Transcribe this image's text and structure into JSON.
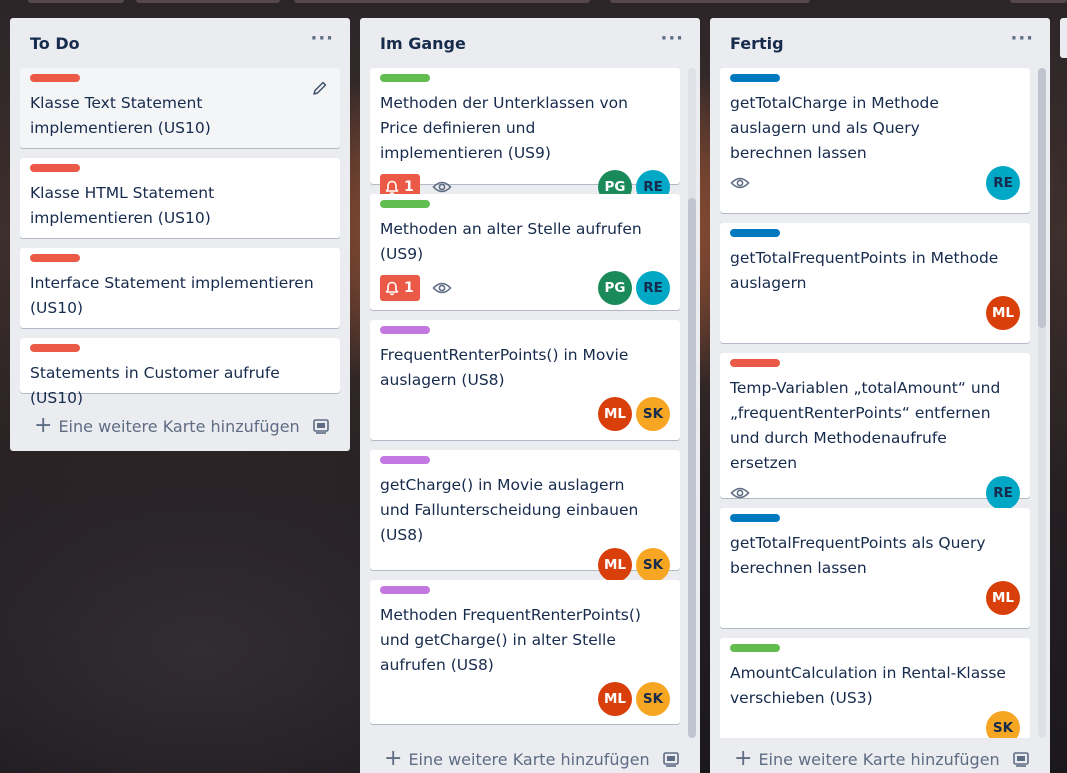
{
  "colors": {
    "label_red": "#eb5a46",
    "label_green": "#61bd4f",
    "label_purple": "#c377e0",
    "label_blue": "#0079bf",
    "due_badge": "#eb5a46",
    "avatar_PG": "#1b8a5a",
    "avatar_RE": "#00a8c6",
    "avatar_ML": "#d93f0b",
    "avatar_SK": "#f6a623"
  },
  "icons": {
    "list_menu": "ellipsis-icon",
    "edit": "pencil-icon",
    "due": "bell-icon",
    "watch": "eye-icon",
    "add": "plus-icon",
    "template": "card-template-icon"
  },
  "lists": [
    {
      "title": "To Do",
      "menu": "···",
      "add_label": "Eine weitere Karte hinzufügen",
      "cards": [
        {
          "label": "label_red",
          "text": "Klasse Text Statement implementieren (US10)"
        },
        {
          "label": "label_red",
          "text": "Klasse HTML Statement implementieren (US10)"
        },
        {
          "label": "label_red",
          "text": "Interface Statement implementieren (US10)"
        },
        {
          "label": "label_red",
          "text": "Statements in Customer aufrufe (US10)"
        }
      ]
    },
    {
      "title": "Im Gange",
      "menu": "···",
      "add_label": "Eine weitere Karte hinzufügen",
      "cards": [
        {
          "label": "label_green",
          "text": "Methoden der Unterklassen von Price definieren und implementieren (US9)",
          "due": "1",
          "members": [
            "PG",
            "RE"
          ]
        },
        {
          "label": "label_green",
          "text": "Methoden an alter Stelle aufrufen (US9)",
          "due": "1",
          "members": [
            "PG",
            "RE"
          ]
        },
        {
          "label": "label_purple",
          "text": "FrequentRenterPoints() in Movie auslagern (US8)",
          "members": [
            "ML",
            "SK"
          ]
        },
        {
          "label": "label_purple",
          "text": "getCharge() in Movie auslagern und Fallunterscheidung einbauen (US8)",
          "members": [
            "ML",
            "SK"
          ]
        },
        {
          "label": "label_purple",
          "text": "Methoden FrequentRenterPoints() und getCharge() in alter Stelle aufrufen (US8)",
          "members": [
            "ML",
            "SK"
          ]
        }
      ]
    },
    {
      "title": "Fertig",
      "menu": "···",
      "add_label": "Eine weitere Karte hinzufügen",
      "cards": [
        {
          "label": "label_blue",
          "text": "getTotalCharge in Methode auslagern und als Query berechnen lassen",
          "members": [
            "RE"
          ]
        },
        {
          "label": "label_blue",
          "text": "getTotalFrequentPoints in Methode auslagern",
          "members": [
            "ML"
          ]
        },
        {
          "label": "label_red",
          "text": "Temp-Variablen „totalAmount“ und „frequentRenterPoints“ entfernen und durch Methodenaufrufe ersetzen",
          "members": [
            "RE"
          ]
        },
        {
          "label": "label_blue",
          "text": "getTotalFrequentPoints als Query berechnen lassen",
          "members": [
            "ML"
          ]
        },
        {
          "label": "label_green",
          "text": "AmountCalculation in Rental-Klasse verschieben (US3)",
          "members": [
            "SK"
          ]
        }
      ]
    }
  ]
}
